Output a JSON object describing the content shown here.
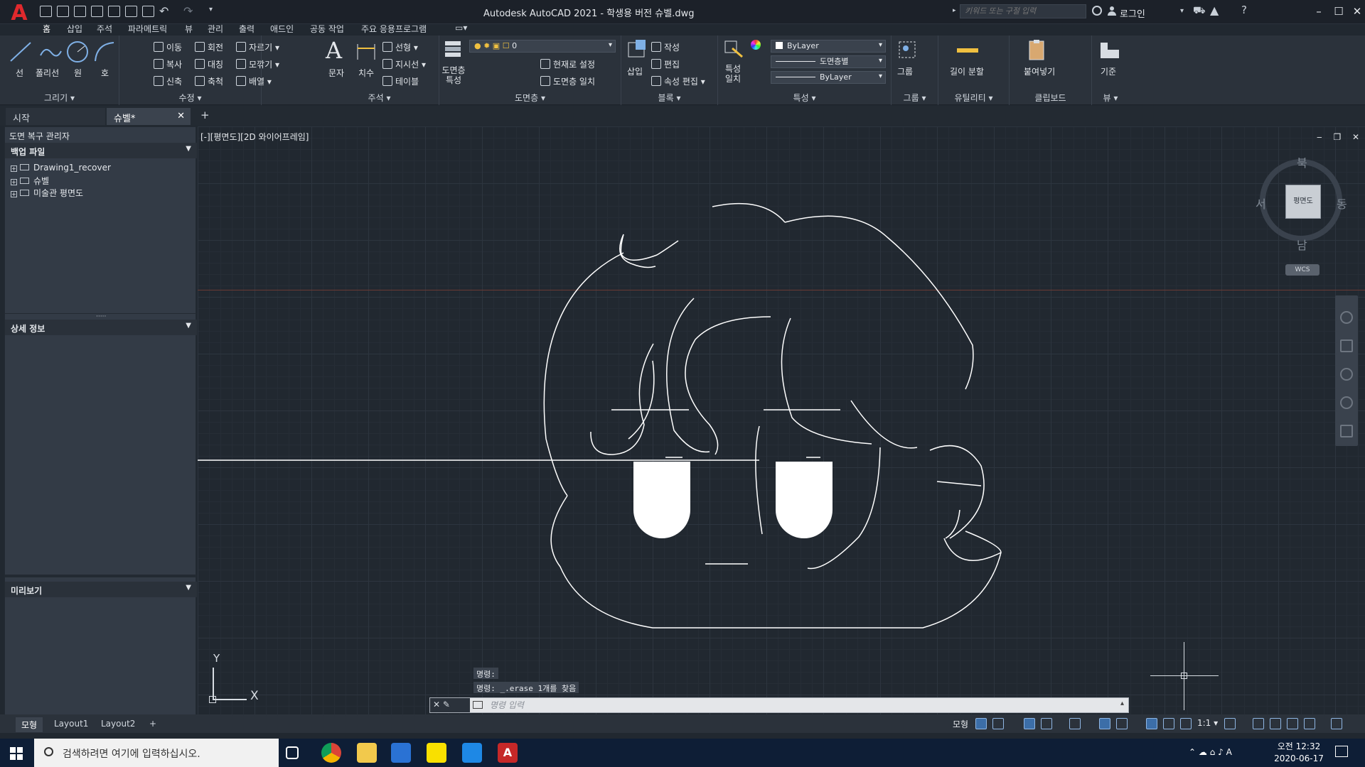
{
  "app": {
    "title": "Autodesk AutoCAD 2021 - 학생용 버전    슈벨.dwg",
    "logo": "A",
    "search_placeholder": "키워드 또는 구절 입력",
    "login": "로그인"
  },
  "menu_tabs": [
    "홈",
    "삽입",
    "주석",
    "파라메트릭",
    "뷰",
    "관리",
    "출력",
    "애드인",
    "공동 작업",
    "주요 응용프로그램"
  ],
  "ribbon": {
    "draw": {
      "title": "그리기",
      "line": "선",
      "polyline": "폴리선",
      "circle": "원",
      "arc": "호"
    },
    "modify": {
      "title": "수정",
      "move": "이동",
      "rotate": "회전",
      "trim": "자르기",
      "copy": "복사",
      "mirror": "대칭",
      "fillet": "모깎기",
      "stretch": "신축",
      "scale": "축척",
      "array": "배열"
    },
    "annotation": {
      "title": "주석",
      "text": "문자",
      "dimension": "치수",
      "linear": "선형",
      "leader": "지시선",
      "table": "테이블"
    },
    "layers": {
      "title": "도면층",
      "properties": "도면층 특성",
      "layer_value": "0",
      "make_current": "현재로 설정",
      "match": "도면층 일치"
    },
    "block": {
      "title": "블록",
      "insert": "삽입",
      "create": "작성",
      "edit": "편집",
      "edit_attr": "속성 편집"
    },
    "properties": {
      "title": "특성",
      "match": "특성 일치",
      "color": "ByLayer",
      "linetype": "도면층별",
      "lineweight": "ByLayer"
    },
    "groups": {
      "title": "그룹",
      "group": "그룹"
    },
    "utilities": {
      "title": "유틸리티",
      "measure": "길이 분할"
    },
    "clipboard": {
      "title": "클립보드",
      "paste": "붙여넣기"
    },
    "view": {
      "title": "뷰",
      "base": "기준"
    }
  },
  "doc_tabs": {
    "start": "시작",
    "current": "슈벨*",
    "close": "✕",
    "add": "+"
  },
  "recovery": {
    "title": "도면 복구 관리자",
    "backup_header": "백업 파일",
    "files": [
      "Drawing1_recover",
      "슈벨",
      "미술관 평면도"
    ],
    "details_header": "상세 정보",
    "preview_header": "미리보기"
  },
  "viewport": {
    "label": "[-][평면도][2D 와이어프레임]",
    "controls": "‒ ❐ ✕"
  },
  "viewcube": {
    "face": "평면도",
    "north": "북",
    "south": "남",
    "west": "서",
    "east": "동",
    "wcs": "WCS"
  },
  "ucs": {
    "x": "X",
    "y": "Y"
  },
  "command": {
    "history": [
      "명령:",
      "명령: _.erase 1개를 찾음"
    ],
    "placeholder": "명령 입력",
    "left_icons": "✕ ✎"
  },
  "layout_tabs": [
    "모형",
    "Layout1",
    "Layout2",
    "+"
  ],
  "status": {
    "model": "모형",
    "scale": "1:1 ▾"
  },
  "taskbar": {
    "search": "검색하려면 여기에 입력하십시오.",
    "time": "오전 12:32",
    "date": "2020-06-17"
  },
  "colors": {
    "accent": "#e0292d",
    "canvas": "#212830",
    "ribbon": "#2b323b",
    "taskbar": "#0e1e36"
  }
}
